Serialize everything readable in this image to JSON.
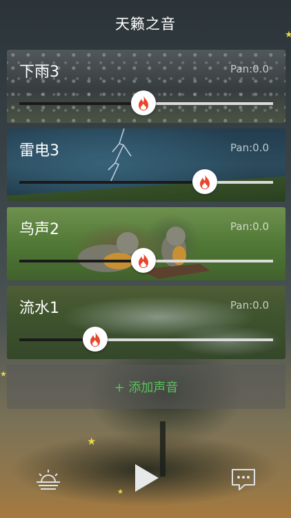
{
  "header": {
    "title": "天籁之音"
  },
  "sounds": [
    {
      "name": "下雨3",
      "pan": "Pan:0.0",
      "volume": 0.49
    },
    {
      "name": "雷电3",
      "pan": "Pan:0.0",
      "volume": 0.73
    },
    {
      "name": "鸟声2",
      "pan": "Pan:0.0",
      "volume": 0.49
    },
    {
      "name": "流水1",
      "pan": "Pan:0.0",
      "volume": 0.3
    }
  ],
  "add_button": {
    "label": "+ 添加声音"
  },
  "toolbar": {
    "left_icon": "sunrise-icon",
    "center_icon": "play-icon",
    "right_icon": "chat-icon"
  },
  "colors": {
    "accent_green": "#59c25a",
    "flame": "#e8452c",
    "track_active": "#1a1a1a",
    "track_inactive": "#dcdcdc"
  }
}
